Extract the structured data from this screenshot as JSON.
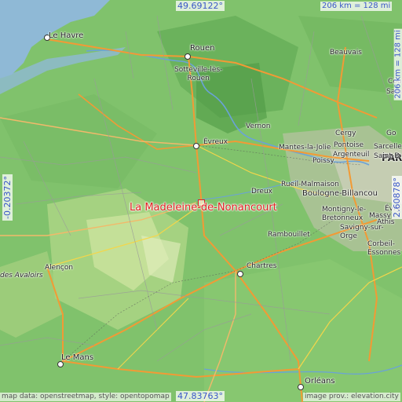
{
  "map": {
    "place_name": "La Madeleine-de-Nonancourt",
    "coords": {
      "top": "49.69122°",
      "bottom": "47.83763°",
      "left": "-0.20372°",
      "right": "2.60878°"
    },
    "scale": {
      "horizontal": "206 km = 128 mi",
      "vertical": "206 km = 128 mi"
    },
    "credits": {
      "left": "map data: openstreetmap, style: opentopomap",
      "right": "image prov.: elevation.city"
    },
    "cities": {
      "le_havre": "Le Havre",
      "rouen": "Rouen",
      "sotteville": "Sotteville-lès-\nRouen",
      "beauvais": "Beauvais",
      "paris": "PARIS",
      "vernon": "Vernon",
      "evreux": "Évreux",
      "mantes": "Mantes-la-Jolie",
      "cergy": "Cergy",
      "pontoise": "Pontoise",
      "sarcelles": "Sarcelles",
      "argenteuil": "Argenteuil",
      "poissy": "Poissy",
      "saint_d": "Saint-D",
      "rueil": "Rueil-Malmaison",
      "boulogne": "Boulogne-Billancou",
      "dreux": "Dreux",
      "montigny": "Montigny-le-\nBretonneux",
      "massy": "Massy",
      "savigny": "Savigny-sur-\nOrge",
      "evry": "Évry",
      "athis": "Athis",
      "rambouillet": "Rambouillet",
      "corbeil": "Corbeil-\nEssonnes",
      "chartres": "Chartres",
      "alencon": "Alençon",
      "des_avaloirs": "des Avaloirs",
      "le_mans": "Le Mans",
      "orleans": "Orléans",
      "cou": "Cou",
      "sain": "Sain",
      "go": "Go"
    }
  }
}
